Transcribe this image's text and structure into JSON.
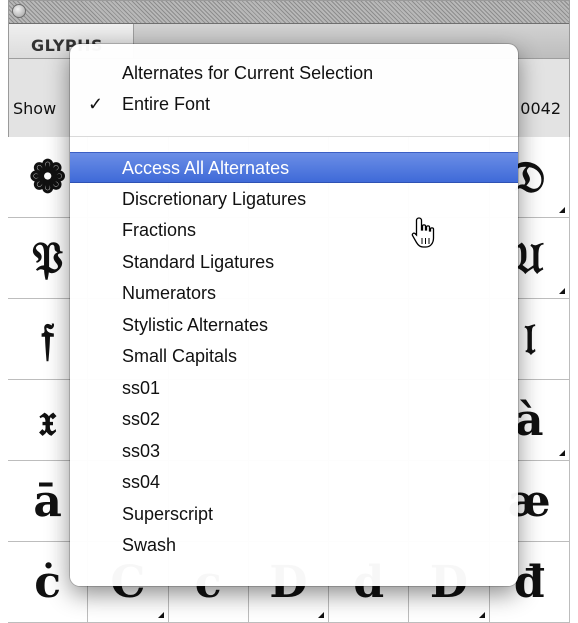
{
  "panel": {
    "tab_label": "GLYPHS",
    "show_label": "Show",
    "code_label": "0042"
  },
  "grid": {
    "cells": [
      [
        "❁",
        "",
        "",
        "",
        "",
        "",
        "𝔇"
      ],
      [
        "𝔓",
        "",
        "",
        "",
        "",
        "",
        "𝔘"
      ],
      [
        "𝔣",
        "",
        "",
        "",
        "",
        "",
        "𝔩"
      ],
      [
        "𝔵",
        "",
        "",
        "",
        "",
        "",
        "à"
      ],
      [
        "ā",
        "",
        "",
        "",
        "",
        "",
        "æ"
      ],
      [
        "ċ",
        "C",
        "c",
        "D",
        "d",
        "D",
        "đ"
      ]
    ]
  },
  "menu": {
    "items": [
      {
        "label": "Alternates for Current Selection",
        "checked": ""
      },
      {
        "label": "Entire Font",
        "checked": "✓"
      },
      {
        "label": "Access All Alternates",
        "checked": ""
      },
      {
        "label": "Discretionary Ligatures",
        "checked": ""
      },
      {
        "label": "Fractions",
        "checked": ""
      },
      {
        "label": "Standard Ligatures",
        "checked": ""
      },
      {
        "label": "Numerators",
        "checked": ""
      },
      {
        "label": "Stylistic Alternates",
        "checked": ""
      },
      {
        "label": "Small Capitals",
        "checked": ""
      },
      {
        "label": "ss01",
        "checked": ""
      },
      {
        "label": "ss02",
        "checked": ""
      },
      {
        "label": "ss03",
        "checked": ""
      },
      {
        "label": "ss04",
        "checked": ""
      },
      {
        "label": "Superscript",
        "checked": ""
      },
      {
        "label": "Swash",
        "checked": ""
      }
    ],
    "highlighted_index": 2,
    "highlight_color": "#4a74e0"
  }
}
